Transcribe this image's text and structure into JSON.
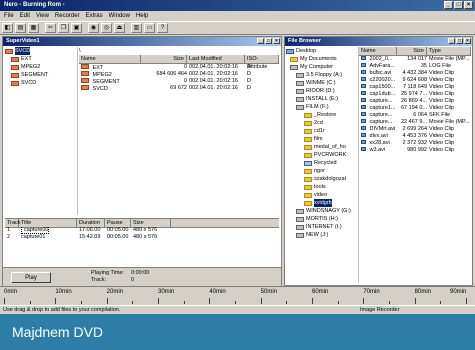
{
  "window": {
    "title": "Nero - Burning Rom -"
  },
  "menu": [
    "File",
    "Edit",
    "View",
    "Recorder",
    "Extras",
    "Window",
    "Help"
  ],
  "left_pane": {
    "title": "SuperVideo1",
    "tree": [
      {
        "label": "SVCD",
        "selected": true
      },
      {
        "label": "EXT"
      },
      {
        "label": "MPEG2"
      },
      {
        "label": "SEGMENT"
      },
      {
        "label": "SVCD"
      }
    ],
    "path": "\\",
    "columns": [
      "Name",
      "Size",
      "Last Modified",
      "ISO-Attribute"
    ],
    "files": [
      {
        "name": "EXT",
        "size": "0",
        "date": "002.04.01. 20:02:16",
        "attr": "D"
      },
      {
        "name": "MPEG2",
        "size": "684 606 464",
        "date": "002.04.01. 20:02:16",
        "attr": "D"
      },
      {
        "name": "SEGMENT",
        "size": "0",
        "date": "002.04.01. 20:02:16",
        "attr": "D"
      },
      {
        "name": "SVCD",
        "size": "69 672",
        "date": "002.04.01. 20:02:16",
        "attr": "D"
      }
    ],
    "tracks_columns": [
      "Track",
      "Title",
      "Duration",
      "Pause",
      "Size"
    ],
    "tracks": [
      {
        "track": "1",
        "title": "capture00",
        "duration": "17:06.00",
        "pause": "00:05.00",
        "size": "480 x 576"
      },
      {
        "track": "2",
        "title": "capture01",
        "duration": "15:42.09",
        "pause": "00:05.00",
        "size": "480 x 576"
      }
    ],
    "play_label": "Play",
    "playing_time_label": "Playing Time:",
    "playing_time_value": "0:00:00",
    "track_label": "Track:",
    "track_value": "0"
  },
  "right_pane": {
    "title": "File Browser",
    "tree": [
      "Desktop",
      "My Documents",
      "My Computer",
      "3.5 Floppy (A:)",
      "WINME (C:)",
      "RIOOR (D:)",
      "INSTALL (E:)",
      "FILM (F:)",
      "_Restore",
      "2cd",
      "cd1r",
      "film",
      "medal_of_ho",
      "PVCRWORK",
      "Recycled",
      "ngor",
      "szakdolgozat",
      "tools",
      "video",
      "xvidgrb",
      "WINDSNAGY (G:)",
      "MORTIS (H:)",
      "INTERNET (I:)",
      "NEW (J:)"
    ],
    "columns": [
      "Name",
      "Size",
      "Type"
    ],
    "files": [
      {
        "name": "2002_0...",
        "size": "134 017",
        "type": "Movie File (MP..."
      },
      {
        "name": "AdvFara...",
        "size": "35",
        "type": "LOG File"
      },
      {
        "name": "bufsc.avi",
        "size": "4 432 384",
        "type": "Video Clip"
      },
      {
        "name": "c220020...",
        "size": "9 624 608",
        "type": "Video Clip"
      },
      {
        "name": "cap1500...",
        "size": "7 118 649",
        "type": "Video Clip"
      },
      {
        "name": "cap1dub...",
        "size": "25 974 7...",
        "type": "Video Clip"
      },
      {
        "name": "capture...",
        "size": "26 869 4...",
        "type": "Video Clip"
      },
      {
        "name": "capture1...",
        "size": "67 194 0...",
        "type": "Video Clip"
      },
      {
        "name": "capture...",
        "size": "6 064",
        "type": "SFK File"
      },
      {
        "name": "capture...",
        "size": "22 467 9...",
        "type": "Movie File (MP..."
      },
      {
        "name": "DIVMrt.avi",
        "size": "2 699 264",
        "type": "Video Clip"
      },
      {
        "name": "divx.avi",
        "size": "4 453 376",
        "type": "Video Clip"
      },
      {
        "name": "xx28.avi",
        "size": "2 372 932",
        "type": "Video Clip"
      },
      {
        "name": "w3.avi",
        "size": "980 992",
        "type": "Video Clip"
      }
    ]
  },
  "ruler": {
    "labels": [
      "0min",
      "10min",
      "20min",
      "30min",
      "40min",
      "50min",
      "60min",
      "70min",
      "80min",
      "90min"
    ]
  },
  "status": {
    "left": "Use drag & drop to add files to your compilation.",
    "right": "Image Recorder"
  },
  "caption": "Majdnem DVD"
}
